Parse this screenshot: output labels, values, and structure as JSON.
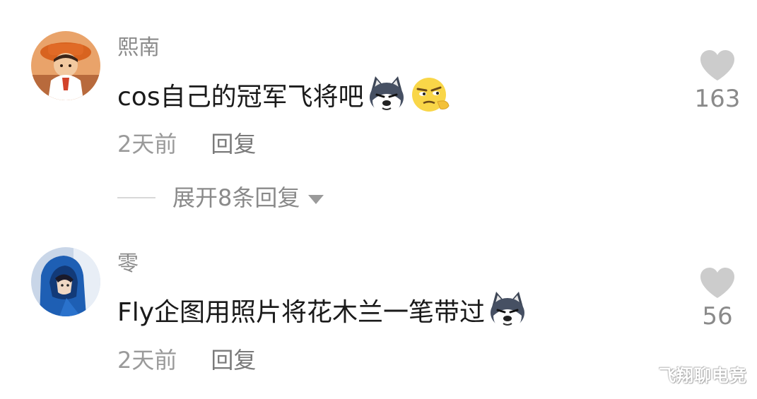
{
  "comments": [
    {
      "username": "熙南",
      "text": "cos自己的冠军飞将吧",
      "emojis": [
        "husky-dog-emoji",
        "smirk-face-emoji"
      ],
      "time": "2天前",
      "reply_label": "回复",
      "expand_replies_label": "展开8条回复",
      "like_count": "163"
    },
    {
      "username": "零",
      "text": "Fly企图用照片将花木兰一笔带过",
      "emojis": [
        "husky-dog-emoji"
      ],
      "time": "2天前",
      "reply_label": "回复",
      "like_count": "56"
    }
  ],
  "watermark": "飞翔聊电竞",
  "colors": {
    "username": "#8a8a8a",
    "text": "#1a1a1a",
    "meta": "#9a9a9a",
    "heart": "#cccccc"
  }
}
